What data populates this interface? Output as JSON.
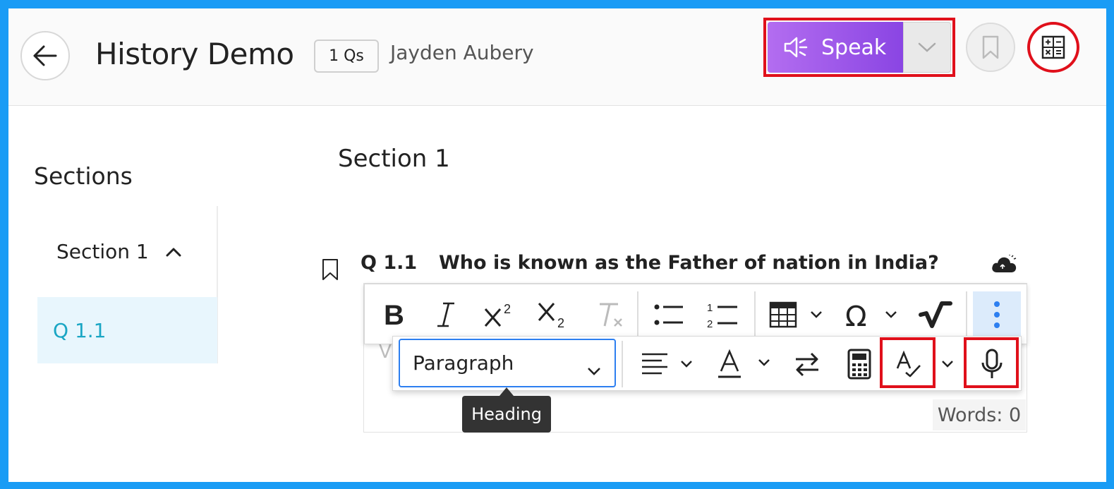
{
  "header": {
    "back_icon": "arrow-left-icon",
    "title": "History Demo",
    "question_count": "1 Qs",
    "author": "Jayden Aubery",
    "speak_label": "Speak",
    "speak_icon": "speaker-icon",
    "bookmark_icon": "bookmark-icon",
    "calculator_icon": "calculator-icon"
  },
  "sidebar": {
    "heading": "Sections",
    "section_label": "Section 1",
    "question_label": "Q 1.1"
  },
  "main": {
    "section_title": "Section 1",
    "question": {
      "number": "Q 1.1",
      "text": "Who is known as the Father of nation in India?"
    }
  },
  "editor": {
    "partial_text": "V",
    "paragraph_select": "Paragraph",
    "tooltip": "Heading",
    "word_count": "Words: 0"
  },
  "colors": {
    "accent": "#8a45e3",
    "frame": "#199cf5",
    "highlight": "#e0101b",
    "link": "#1aa6c4"
  }
}
